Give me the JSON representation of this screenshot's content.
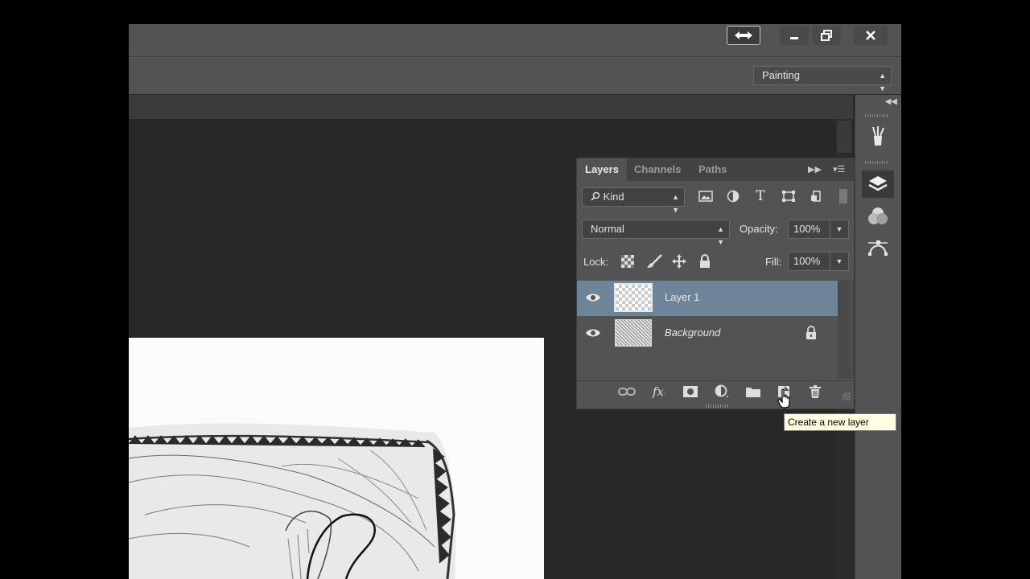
{
  "window": {
    "swap_icon": "arrows-swap-icon",
    "minimize_icon": "minimize-icon",
    "restore_icon": "restore-icon",
    "close_icon": "close-icon"
  },
  "options_bar": {
    "workspace": "Painting"
  },
  "dock": {
    "icons": [
      "brush-presets-icon",
      "layers-icon",
      "adjustments-icon",
      "paths-icon"
    ]
  },
  "layers_panel": {
    "tabs": [
      "Layers",
      "Channels",
      "Paths"
    ],
    "active_tab": "Layers",
    "filter": {
      "kind_label": "Kind",
      "icons": [
        "pixel-filter-icon",
        "adjustment-filter-icon",
        "type-filter-icon",
        "shape-filter-icon",
        "smart-object-filter-icon"
      ]
    },
    "blend_mode": "Normal",
    "opacity_label": "Opacity:",
    "opacity_value": "100%",
    "lock_label": "Lock:",
    "fill_label": "Fill:",
    "fill_value": "100%",
    "layers": [
      {
        "name": "Layer 1",
        "visible": true,
        "selected": true,
        "locked": false
      },
      {
        "name": "Background",
        "visible": true,
        "selected": false,
        "locked": true
      }
    ],
    "footer_icons": [
      "link-layers-icon",
      "layer-style-icon",
      "add-mask-icon",
      "adjustment-layer-icon",
      "group-folder-icon",
      "new-layer-icon",
      "delete-layer-icon"
    ]
  },
  "tooltip": {
    "text": "Create a new layer"
  },
  "colors": {
    "chrome": "#535353",
    "canvas_bg": "#282828",
    "selected_layer": "#6e8499",
    "tooltip_bg": "#ffffe1"
  }
}
